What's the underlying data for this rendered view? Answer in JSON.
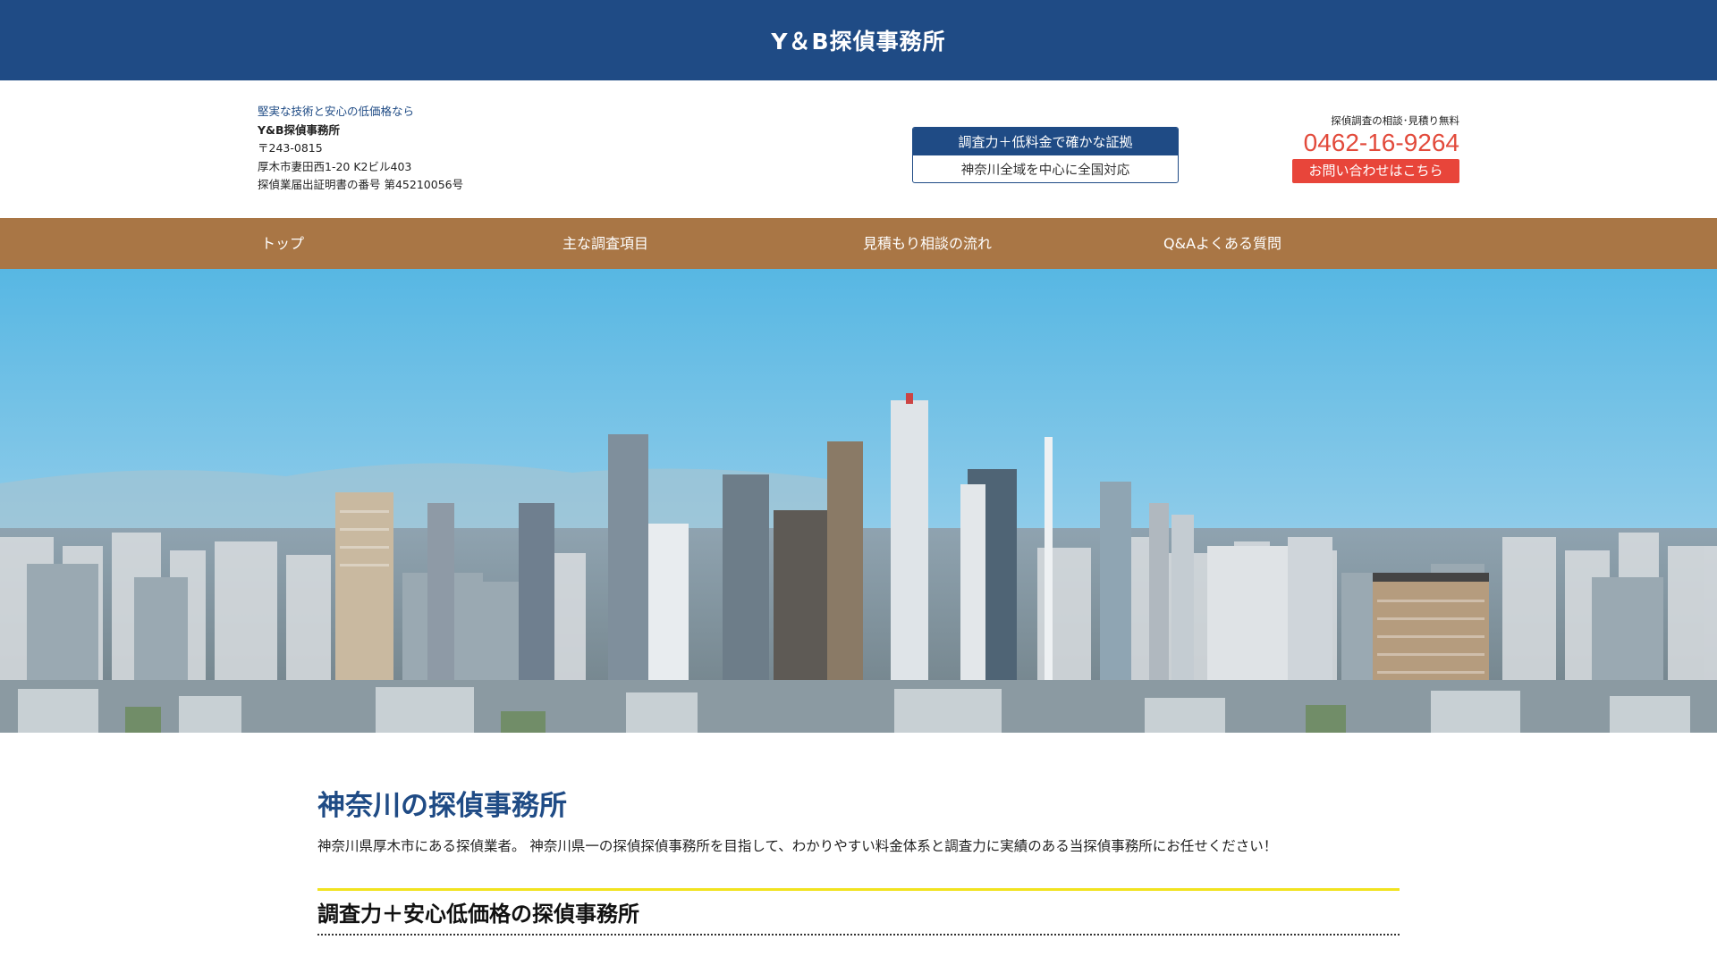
{
  "site": {
    "title": "Y＆B探偵事務所"
  },
  "header": {
    "tagline": "堅実な技術と安心の低価格なら",
    "company": "Y&B探偵事務所",
    "postal": "〒243-0815",
    "address": "厚木市妻田西1-20 K2ビル403",
    "license": "探偵業届出証明書の番号 第45210056号",
    "feature_box": {
      "line1": "調査力＋低料金で確かな証拠",
      "line2": "神奈川全域を中心に全国対応"
    },
    "contact": {
      "note": "探偵調査の相談･見積り無料",
      "phone": "0462-16-9264",
      "button": "お問い合わせはこちら"
    }
  },
  "nav": {
    "items": [
      {
        "label": "トップ"
      },
      {
        "label": "主な調査項目"
      },
      {
        "label": "見積もり相談の流れ"
      },
      {
        "label": "Q&Aよくある質問"
      }
    ]
  },
  "colors": {
    "brand_blue": "#1f4b85",
    "nav_brown": "#a97645",
    "accent_red": "#e8453a",
    "divider_yellow": "#f1e31f"
  },
  "main": {
    "heading": "神奈川の探偵事務所",
    "lead": "神奈川県厚木市にある探偵業者。 神奈川県一の探偵探偵事務所を目指して、わかりやすい料金体系と調査力に実績のある当探偵事務所にお任せください！",
    "section_heading": "調査力＋安心低価格の探偵事務所"
  }
}
